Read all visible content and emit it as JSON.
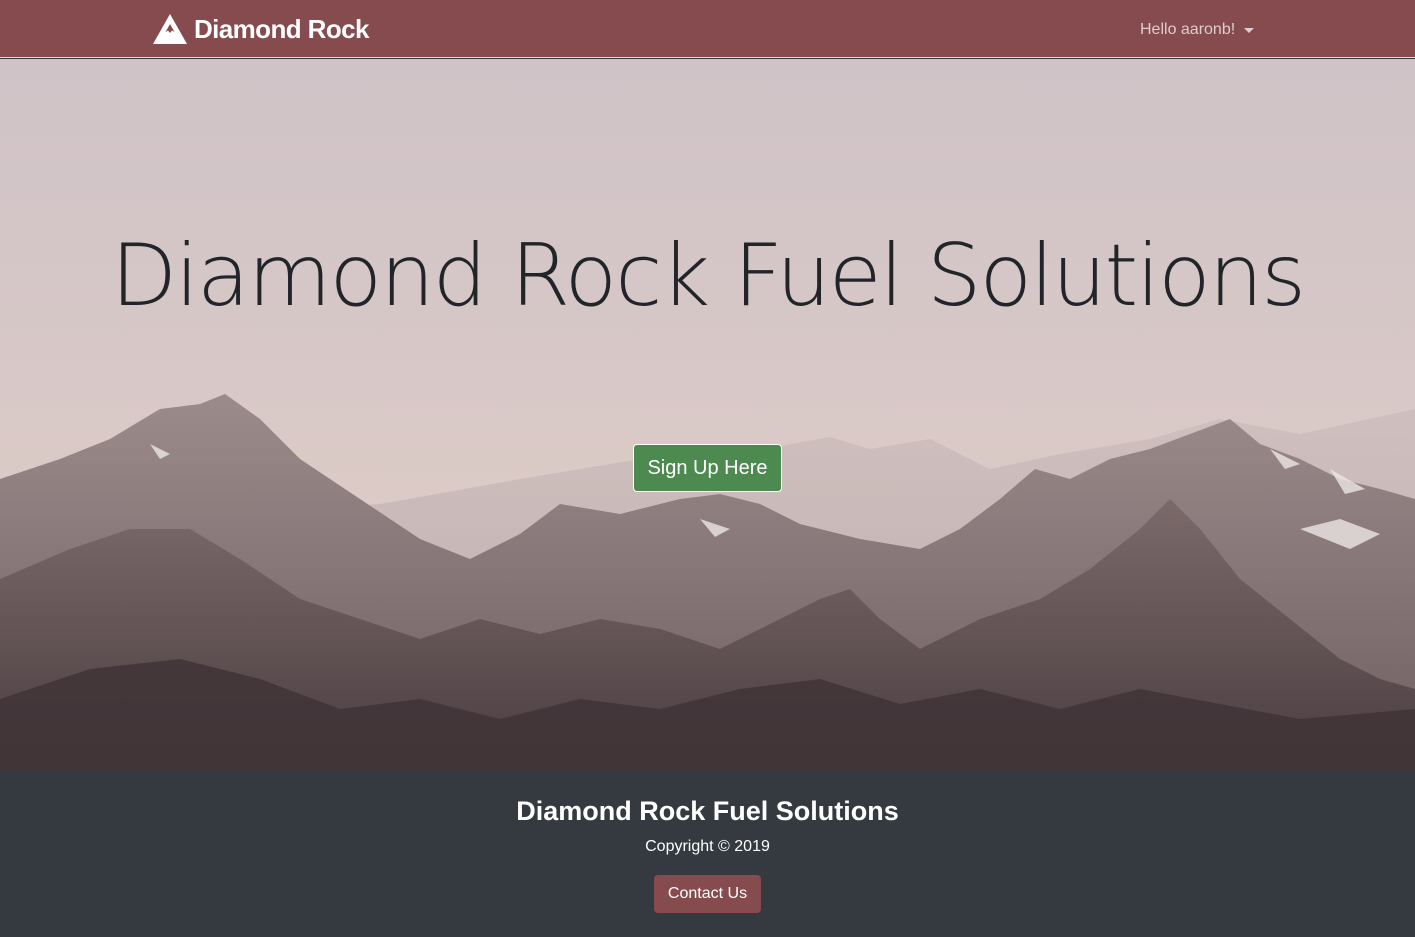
{
  "navbar": {
    "brand_name": "Diamond Rock",
    "brand_icon": "mountain-icon",
    "user_greeting": "Hello aaronb!",
    "user_menu_icon": "chevron-down-icon",
    "background_color": "#854b4f"
  },
  "hero": {
    "title": "Diamond Rock Fuel Solutions",
    "signup_button_label": "Sign Up Here",
    "signup_button_color": "#4c8a4f"
  },
  "footer": {
    "title": "Diamond Rock Fuel Solutions",
    "copyright": "Copyright © 2019",
    "contact_button_label": "Contact Us",
    "background_color": "#343a40"
  }
}
